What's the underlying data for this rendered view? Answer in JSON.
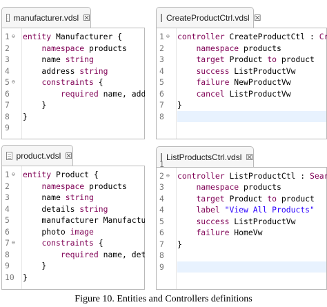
{
  "caption": "Figure 10.  Entities and Controllers definitions",
  "panels": [
    {
      "tab_label": "manufacturer.vdsl",
      "close_glyph": "☒",
      "lines": [
        {
          "n": "1",
          "fold": "⊖",
          "tokens": [
            {
              "k": "kw",
              "t": "entity"
            },
            {
              "k": "",
              "t": " Manufacturer {"
            }
          ]
        },
        {
          "n": "2",
          "fold": "",
          "tokens": [
            {
              "k": "",
              "t": "    "
            },
            {
              "k": "kw",
              "t": "namespace"
            },
            {
              "k": "",
              "t": " products"
            }
          ]
        },
        {
          "n": "3",
          "fold": "",
          "tokens": [
            {
              "k": "",
              "t": "    name "
            },
            {
              "k": "kw",
              "t": "string"
            }
          ]
        },
        {
          "n": "4",
          "fold": "",
          "tokens": [
            {
              "k": "",
              "t": "    address "
            },
            {
              "k": "kw",
              "t": "string"
            }
          ]
        },
        {
          "n": "5",
          "fold": "⊖",
          "tokens": [
            {
              "k": "",
              "t": "    "
            },
            {
              "k": "kw",
              "t": "constraints"
            },
            {
              "k": "",
              "t": " {"
            }
          ]
        },
        {
          "n": "6",
          "fold": "",
          "tokens": [
            {
              "k": "",
              "t": "        "
            },
            {
              "k": "kw",
              "t": "required"
            },
            {
              "k": "",
              "t": " name, address"
            }
          ]
        },
        {
          "n": "7",
          "fold": "",
          "tokens": [
            {
              "k": "",
              "t": "    }"
            }
          ]
        },
        {
          "n": "8",
          "fold": "",
          "tokens": [
            {
              "k": "",
              "t": "}"
            }
          ]
        },
        {
          "n": "9",
          "fold": "",
          "tokens": []
        }
      ]
    },
    {
      "tab_label": "CreateProductCtrl.vdsl",
      "close_glyph": "☒",
      "lines": [
        {
          "n": "1",
          "fold": "⊖",
          "tokens": [
            {
              "k": "kw",
              "t": "controller"
            },
            {
              "k": "",
              "t": " CreateProductCtl : "
            },
            {
              "k": "kw",
              "t": "Create"
            },
            {
              "k": "",
              "t": " {"
            }
          ]
        },
        {
          "n": "2",
          "fold": "",
          "tokens": [
            {
              "k": "",
              "t": "    "
            },
            {
              "k": "kw",
              "t": "namespace"
            },
            {
              "k": "",
              "t": " products"
            }
          ]
        },
        {
          "n": "3",
          "fold": "",
          "tokens": [
            {
              "k": "",
              "t": "    "
            },
            {
              "k": "kw",
              "t": "target"
            },
            {
              "k": "",
              "t": " Product "
            },
            {
              "k": "kw",
              "t": "to"
            },
            {
              "k": "",
              "t": " product"
            }
          ]
        },
        {
          "n": "4",
          "fold": "",
          "tokens": [
            {
              "k": "",
              "t": "    "
            },
            {
              "k": "kw",
              "t": "success"
            },
            {
              "k": "",
              "t": " ListProductVw"
            }
          ]
        },
        {
          "n": "5",
          "fold": "",
          "tokens": [
            {
              "k": "",
              "t": "    "
            },
            {
              "k": "kw",
              "t": "failure"
            },
            {
              "k": "",
              "t": " NewProductVw"
            }
          ]
        },
        {
          "n": "6",
          "fold": "",
          "tokens": [
            {
              "k": "",
              "t": "    "
            },
            {
              "k": "kw",
              "t": "cancel"
            },
            {
              "k": "",
              "t": " ListProductVw"
            }
          ]
        },
        {
          "n": "7",
          "fold": "",
          "tokens": [
            {
              "k": "",
              "t": "}"
            }
          ]
        },
        {
          "n": "8",
          "fold": "",
          "tokens": []
        }
      ]
    },
    {
      "tab_label": "product.vdsl",
      "close_glyph": "☒",
      "lines": [
        {
          "n": "1",
          "fold": "⊖",
          "tokens": [
            {
              "k": "kw",
              "t": "entity"
            },
            {
              "k": "",
              "t": " Product {"
            }
          ]
        },
        {
          "n": "2",
          "fold": "",
          "tokens": [
            {
              "k": "",
              "t": "    "
            },
            {
              "k": "kw",
              "t": "namespace"
            },
            {
              "k": "",
              "t": " products"
            }
          ]
        },
        {
          "n": "3",
          "fold": "",
          "tokens": [
            {
              "k": "",
              "t": "    name "
            },
            {
              "k": "kw",
              "t": "string"
            }
          ]
        },
        {
          "n": "4",
          "fold": "",
          "tokens": [
            {
              "k": "",
              "t": "    details "
            },
            {
              "k": "kw",
              "t": "string"
            }
          ]
        },
        {
          "n": "5",
          "fold": "",
          "tokens": [
            {
              "k": "",
              "t": "    manufacturer Manufacturer"
            }
          ]
        },
        {
          "n": "6",
          "fold": "",
          "tokens": [
            {
              "k": "",
              "t": "    photo "
            },
            {
              "k": "kw",
              "t": "image"
            }
          ]
        },
        {
          "n": "7",
          "fold": "⊖",
          "tokens": [
            {
              "k": "",
              "t": "    "
            },
            {
              "k": "kw",
              "t": "constraints"
            },
            {
              "k": "",
              "t": " {"
            }
          ]
        },
        {
          "n": "8",
          "fold": "",
          "tokens": [
            {
              "k": "",
              "t": "        "
            },
            {
              "k": "kw",
              "t": "required"
            },
            {
              "k": "",
              "t": " name, details,"
            }
          ]
        },
        {
          "n": "9",
          "fold": "",
          "tokens": [
            {
              "k": "",
              "t": "    }"
            }
          ]
        },
        {
          "n": "10",
          "fold": "",
          "tokens": [
            {
              "k": "",
              "t": "}"
            }
          ]
        }
      ]
    },
    {
      "tab_label": "ListProductsCtrl.vdsl",
      "close_glyph": "☒",
      "lines": [
        {
          "n": "1",
          "fold": "",
          "tokens": []
        },
        {
          "n": "2",
          "fold": "⊖",
          "tokens": [
            {
              "k": "kw",
              "t": "controller"
            },
            {
              "k": "",
              "t": " ListProductCtl : "
            },
            {
              "k": "kw",
              "t": "Search"
            },
            {
              "k": "",
              "t": " {"
            }
          ]
        },
        {
          "n": "3",
          "fold": "",
          "tokens": [
            {
              "k": "",
              "t": "    "
            },
            {
              "k": "kw",
              "t": "namespace"
            },
            {
              "k": "",
              "t": " products"
            }
          ]
        },
        {
          "n": "4",
          "fold": "",
          "tokens": [
            {
              "k": "",
              "t": "    "
            },
            {
              "k": "kw",
              "t": "target"
            },
            {
              "k": "",
              "t": " Product "
            },
            {
              "k": "kw",
              "t": "to"
            },
            {
              "k": "",
              "t": " product"
            }
          ]
        },
        {
          "n": "4",
          "fold": "",
          "tokens": [
            {
              "k": "",
              "t": "    "
            },
            {
              "k": "kw",
              "t": "label"
            },
            {
              "k": "",
              "t": " "
            },
            {
              "k": "str",
              "t": "\"View All Products\""
            }
          ]
        },
        {
          "n": "5",
          "fold": "",
          "tokens": [
            {
              "k": "",
              "t": "    "
            },
            {
              "k": "kw",
              "t": "success"
            },
            {
              "k": "",
              "t": " ListProductVw"
            }
          ]
        },
        {
          "n": "6",
          "fold": "",
          "tokens": [
            {
              "k": "",
              "t": "    "
            },
            {
              "k": "kw",
              "t": "failure"
            },
            {
              "k": "",
              "t": " HomeVw"
            }
          ]
        },
        {
          "n": "7",
          "fold": "",
          "tokens": [
            {
              "k": "",
              "t": "}"
            }
          ]
        },
        {
          "n": "8",
          "fold": "",
          "tokens": []
        },
        {
          "n": "9",
          "fold": "",
          "tokens": []
        }
      ]
    }
  ]
}
